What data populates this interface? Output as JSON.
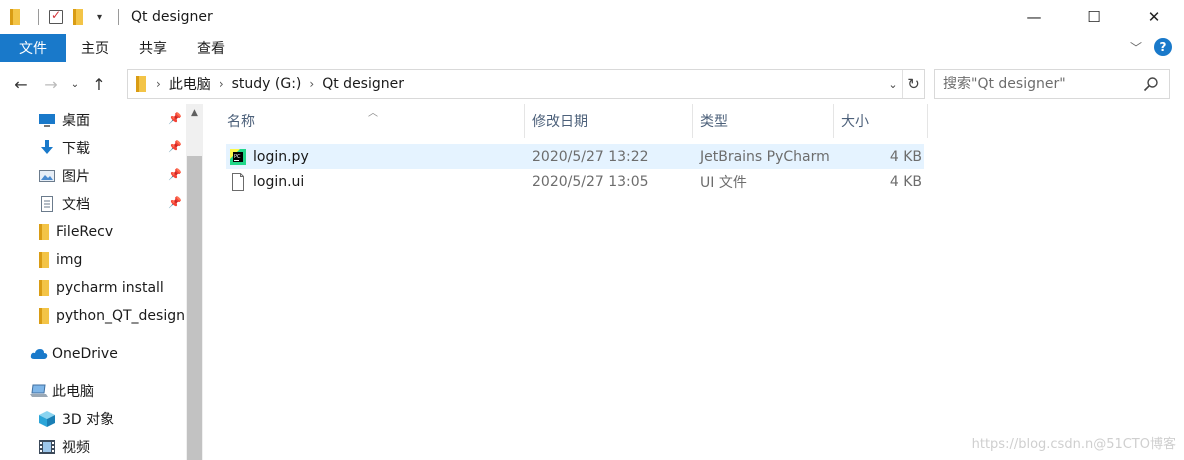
{
  "window": {
    "title": "Qt designer",
    "controls": {
      "minimize": "—",
      "maximize": "☐",
      "close": "✕"
    }
  },
  "ribbon": {
    "tabs": [
      "文件",
      "主页",
      "共享",
      "查看"
    ],
    "help_label": "?"
  },
  "navigation": {
    "back": "←",
    "forward": "→",
    "recent": "⌄",
    "up": "↑",
    "breadcrumb": [
      "此电脑",
      "study (G:)",
      "Qt designer"
    ],
    "search_placeholder": "搜索\"Qt designer\""
  },
  "sidebar": {
    "pinned": [
      {
        "label": "桌面",
        "icon": "desktop-icon"
      },
      {
        "label": "下载",
        "icon": "download-icon"
      },
      {
        "label": "图片",
        "icon": "pictures-icon"
      },
      {
        "label": "文档",
        "icon": "documents-icon"
      }
    ],
    "folders": [
      "FileRecv",
      "img",
      "pycharm install",
      "python_QT_design"
    ],
    "onedrive": "OneDrive",
    "this_pc": "此电脑",
    "pc_items": [
      "3D 对象",
      "视频"
    ]
  },
  "columns": [
    "名称",
    "修改日期",
    "类型",
    "大小"
  ],
  "files": [
    {
      "name": "login.py",
      "modified": "2020/5/27 13:22",
      "type": "JetBrains PyCharm",
      "size": "4 KB",
      "icon": "pycharm-file-icon",
      "selected": true
    },
    {
      "name": "login.ui",
      "modified": "2020/5/27 13:05",
      "type": "UI 文件",
      "size": "4 KB",
      "icon": "blank-file-icon",
      "selected": false
    }
  ],
  "watermark": "https://blog.csdn.n@51CTO博客",
  "colors": {
    "accent": "#1979ca",
    "selection": "#e5f3ff",
    "folder": "#f3c447",
    "header_text": "#4c607a"
  }
}
